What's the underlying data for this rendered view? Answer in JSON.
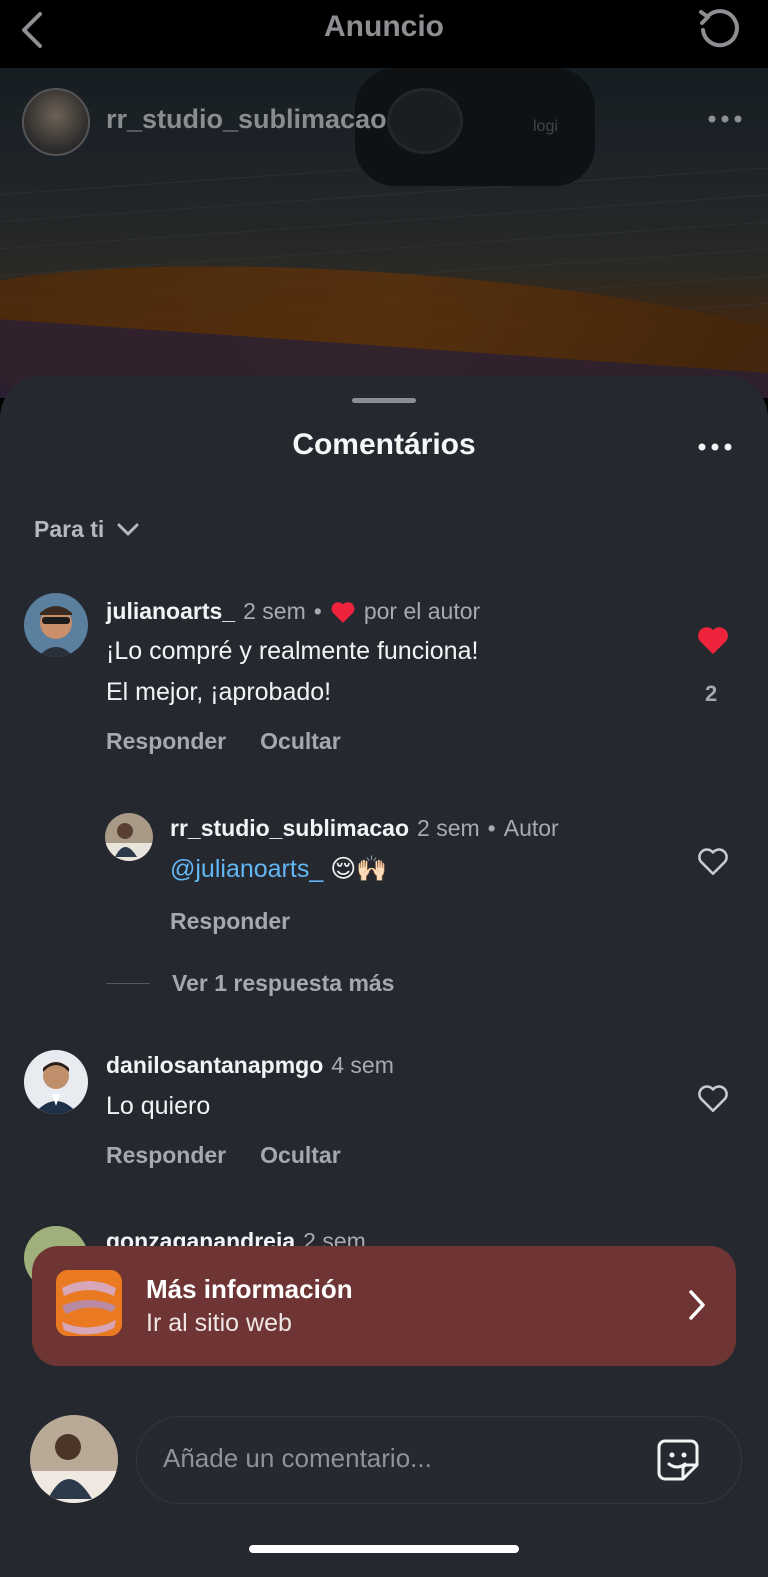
{
  "header": {
    "title": "Anuncio"
  },
  "post": {
    "username": "rr_studio_sublimacao",
    "webcam_brand": "logi"
  },
  "sheet": {
    "title": "Comentários",
    "filter_label": "Para ti"
  },
  "comments": [
    {
      "user": "julianoarts_",
      "time": "2 sem",
      "liked_by_author": "por el autor",
      "lines": [
        "¡Lo compré y realmente funciona!",
        "El mejor, ¡aprobado!"
      ],
      "actions": [
        "Responder",
        "Ocultar"
      ],
      "likes": "2",
      "liked": true
    },
    {
      "user": "rr_studio_sublimacao",
      "time": "2 sem",
      "badge": "Autor",
      "mention": "@julianoarts_",
      "emojis": "😌🙌🏻",
      "actions": [
        "Responder"
      ],
      "liked": false
    },
    {
      "user": "danilosantanapmgo",
      "time": "4 sem",
      "lines": [
        "Lo quiero"
      ],
      "actions": [
        "Responder",
        "Ocultar"
      ],
      "liked": false
    },
    {
      "user": "gonzaganandreia",
      "time": "2 sem"
    }
  ],
  "more_replies": "Ver 1 respuesta más",
  "cta": {
    "title": "Más información",
    "subtitle": "Ir al sitio web"
  },
  "composer": {
    "placeholder": "Añade un comentario..."
  },
  "colors": {
    "sheet_bg": "#25292f",
    "like_red": "#f0233c",
    "mention_blue": "#63b7f5",
    "cta_bg": "#6f3535"
  }
}
